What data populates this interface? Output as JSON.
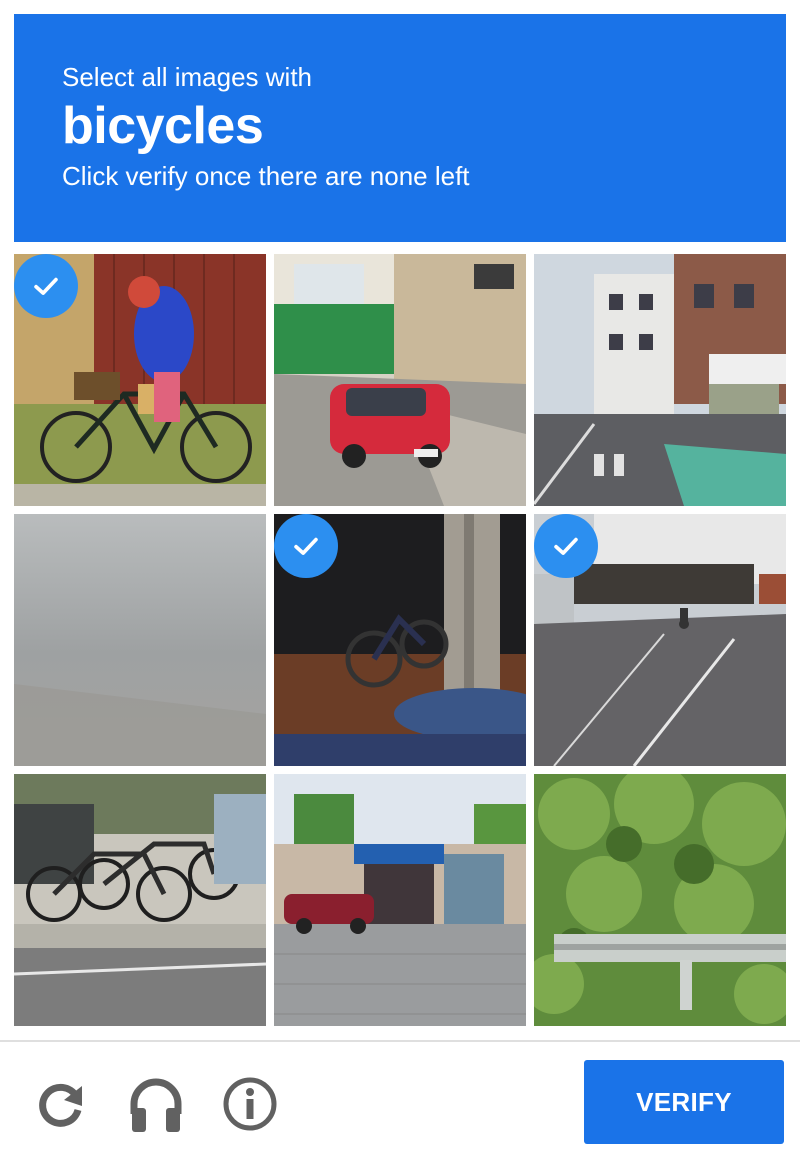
{
  "header": {
    "line1": "Select all images with",
    "target": "bicycles",
    "line3": "Click verify once there are none left"
  },
  "colors": {
    "header_bg": "#1a73e8",
    "check_bg": "#2c8ff0",
    "verify_bg": "#1a73e8"
  },
  "tiles": [
    {
      "content": "woman riding bicycle by red wall",
      "selected": true
    },
    {
      "content": "red car on street",
      "selected": false
    },
    {
      "content": "city street with buildings",
      "selected": false
    },
    {
      "content": "foggy blurred image",
      "selected": false
    },
    {
      "content": "bicycle near pole and table",
      "selected": true
    },
    {
      "content": "street with bike lane",
      "selected": true
    },
    {
      "content": "parked bicycles on sidewalk",
      "selected": false
    },
    {
      "content": "storefront with red car",
      "selected": false
    },
    {
      "content": "green bushes and guardrail",
      "selected": false
    }
  ],
  "footer": {
    "icons": [
      "reload-icon",
      "headphones-icon",
      "info-icon"
    ],
    "verify_label": "VERIFY"
  }
}
